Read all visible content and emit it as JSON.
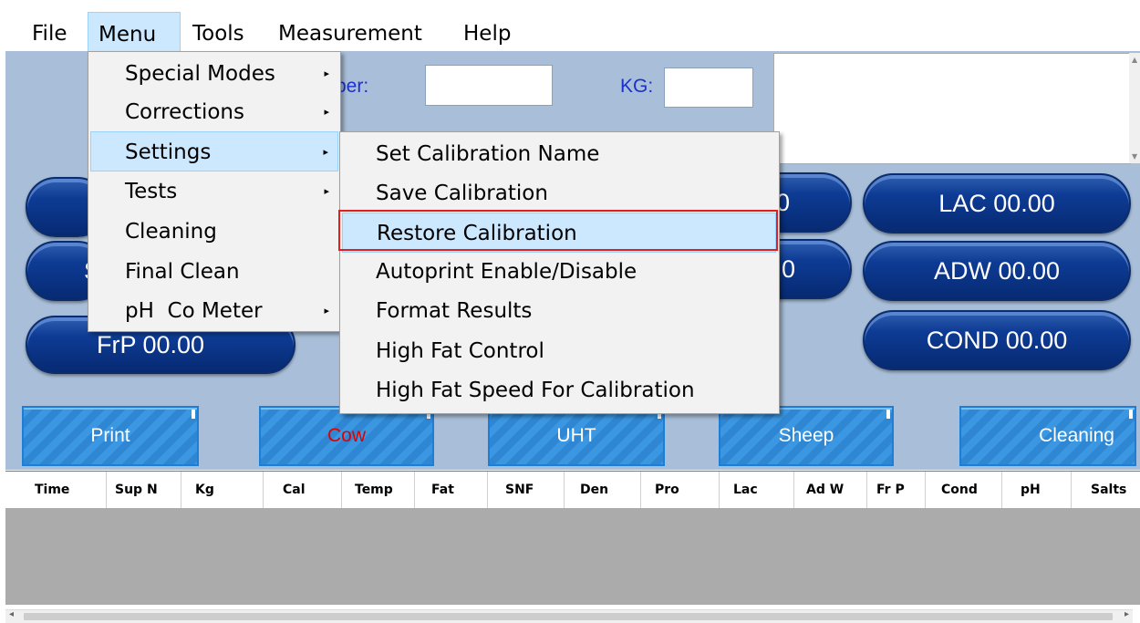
{
  "menubar": {
    "file": "File",
    "menu": "Menu",
    "tools": "Tools",
    "measurement": "Measurement",
    "help": "Help"
  },
  "form": {
    "number_label": "ber:",
    "kg_label": "KG:"
  },
  "pills": {
    "lac": "LAC 00.00",
    "adw": "ADW 00.00",
    "cond": "COND 00.00",
    "frp": "FrP 00.00",
    "partial_s": "S",
    "partial_zero_1": "0",
    "partial_zero_2": "0"
  },
  "buttons": {
    "print": "Print",
    "cow": "Cow",
    "uht": "UHT",
    "sheep": "Sheep",
    "cleaning": "Cleaning"
  },
  "table": {
    "columns": [
      "Time",
      "Sup N",
      "Kg",
      "Cal",
      "Temp",
      "Fat",
      "SNF",
      "Den",
      "Pro",
      "Lac",
      "Ad W",
      "Fr P",
      "Cond",
      "pH",
      "Salts"
    ]
  },
  "menu_dropdown": {
    "items": [
      {
        "label": "Special Modes",
        "submenu": true
      },
      {
        "label": "Corrections",
        "submenu": true
      },
      {
        "label": "Settings",
        "submenu": true
      },
      {
        "label": "Tests",
        "submenu": true
      },
      {
        "label": "Cleaning",
        "submenu": false
      },
      {
        "label": "Final Clean",
        "submenu": false
      },
      {
        "label": "pH  Co Meter",
        "submenu": true
      }
    ]
  },
  "settings_submenu": {
    "items": [
      "Set Calibration Name",
      "Save Calibration",
      "Restore Calibration",
      "Autoprint Enable/Disable",
      "Format Results",
      "High Fat Control",
      "High Fat Speed For Calibration"
    ]
  },
  "colors": {
    "accent_highlight": "#cce8ff",
    "selection_border": "#e02020",
    "cow_text": "#e00000",
    "panel_bg": "#a9bfd9"
  },
  "icons": {
    "submenu_arrow": "right-triangle-icon",
    "scroll_left": "left-arrow-icon",
    "scroll_right": "right-arrow-icon",
    "scroll_up": "up-arrow-icon",
    "scroll_down": "down-arrow-icon"
  }
}
